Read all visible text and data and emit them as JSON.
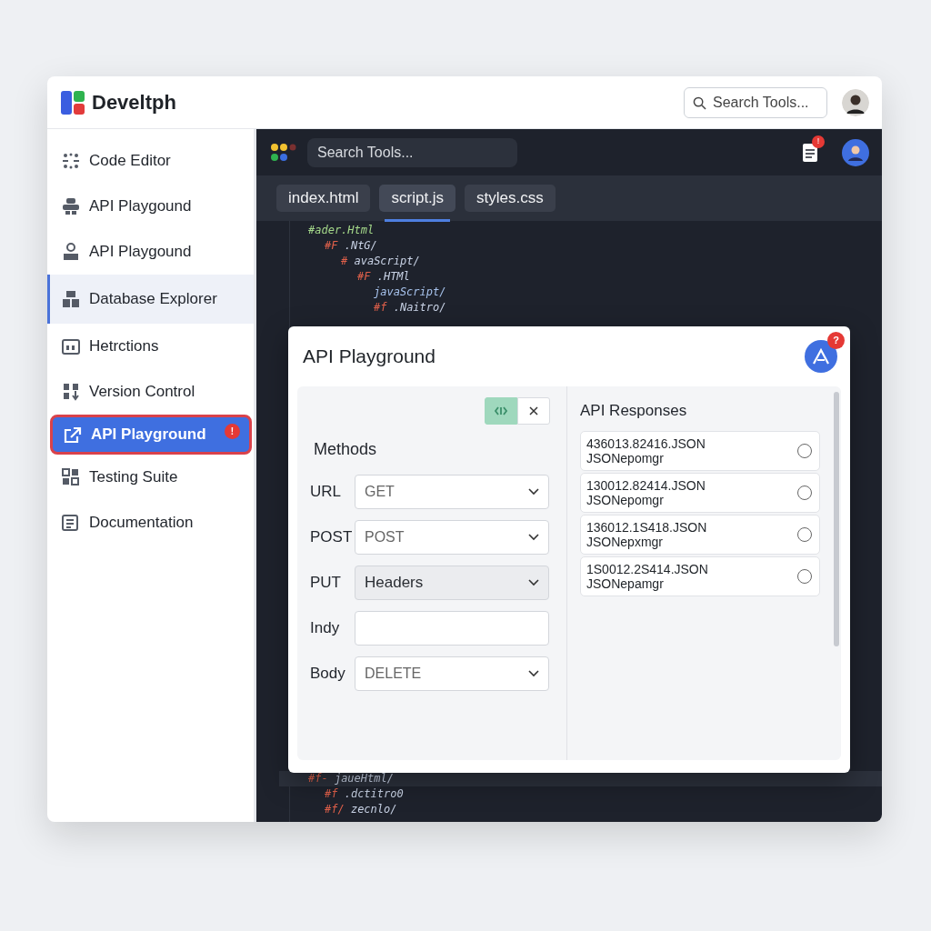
{
  "header": {
    "brand": "Develtph",
    "search": {
      "placeholder": "Search Tools..."
    }
  },
  "sidebar": {
    "items": [
      {
        "label": "Code Editor",
        "selected": false,
        "hovered": false
      },
      {
        "label": "API Playgound",
        "selected": false,
        "hovered": false
      },
      {
        "label": "API Playgound",
        "selected": false,
        "hovered": false
      },
      {
        "label": "Database Explorer",
        "selected": false,
        "hovered": true
      },
      {
        "label": "Hetrctions",
        "selected": false,
        "hovered": false
      },
      {
        "label": "Version Control",
        "selected": false,
        "hovered": false
      },
      {
        "label": "API Playground",
        "selected": true,
        "hovered": false,
        "badge": "!"
      },
      {
        "label": "Testing Suite",
        "selected": false,
        "hovered": false
      },
      {
        "label": "Documentation",
        "selected": false,
        "hovered": false
      }
    ]
  },
  "editor": {
    "search": {
      "placeholder": "Search Tools..."
    },
    "notification_badge": "!",
    "tabs": [
      {
        "label": "index.html",
        "selected": false
      },
      {
        "label": "script.js",
        "selected": true
      },
      {
        "label": "styles.css",
        "selected": false
      }
    ],
    "code_top": [
      {
        "kind": "comment",
        "text": "#ader.Html",
        "children": [
          {
            "kind": "code",
            "tag": "#F",
            "text": ".NtG/",
            "children": [
              {
                "kind": "code",
                "tag": "#",
                "text": "avaScript/",
                "children": [
                  {
                    "kind": "code",
                    "tag": "#F",
                    "text": ".HTMl",
                    "children": [
                      {
                        "kind": "plain",
                        "text": "javaScript/"
                      },
                      {
                        "kind": "code",
                        "tag": "#f",
                        "text": ".Naitro/"
                      }
                    ]
                  }
                ]
              }
            ]
          }
        ]
      }
    ],
    "code_bottom": [
      {
        "kind": "code",
        "tag": "#f-",
        "text": "jaueHtml/",
        "active": true,
        "children": [
          {
            "kind": "code",
            "tag": "#f",
            "text": ".dctitro0",
            "active": false
          },
          {
            "kind": "code",
            "tag": "#f/",
            "text": "zecnlo/",
            "active": false
          }
        ]
      }
    ]
  },
  "modal": {
    "title": "API Playground",
    "badge": "?",
    "methods_title": "Methods",
    "fields": [
      {
        "label": "URL",
        "kind": "select",
        "value": "GET",
        "disabled": false
      },
      {
        "label": "POST",
        "kind": "select",
        "value": "POST",
        "disabled": false
      },
      {
        "label": "PUT",
        "kind": "select",
        "value": "Headers",
        "disabled": true
      },
      {
        "label": "Indy",
        "kind": "input",
        "disabled": false
      },
      {
        "label": "Body",
        "kind": "select",
        "value": "DELETE",
        "disabled": false
      }
    ],
    "responses_title": "API Responses",
    "responses": [
      {
        "line1": "436013.82416.JSON",
        "line2": "JSONepomgr",
        "checked": false
      },
      {
        "line1": "130012.82414.JSON",
        "line2": "JSONepomgr",
        "checked": false
      },
      {
        "line1": "136012.1S418.JSON",
        "line2": "JSONepxmgr",
        "checked": false
      },
      {
        "line1": "1S0012.2S414.JSON",
        "line2": "JSONepamgr",
        "checked": false
      }
    ]
  }
}
